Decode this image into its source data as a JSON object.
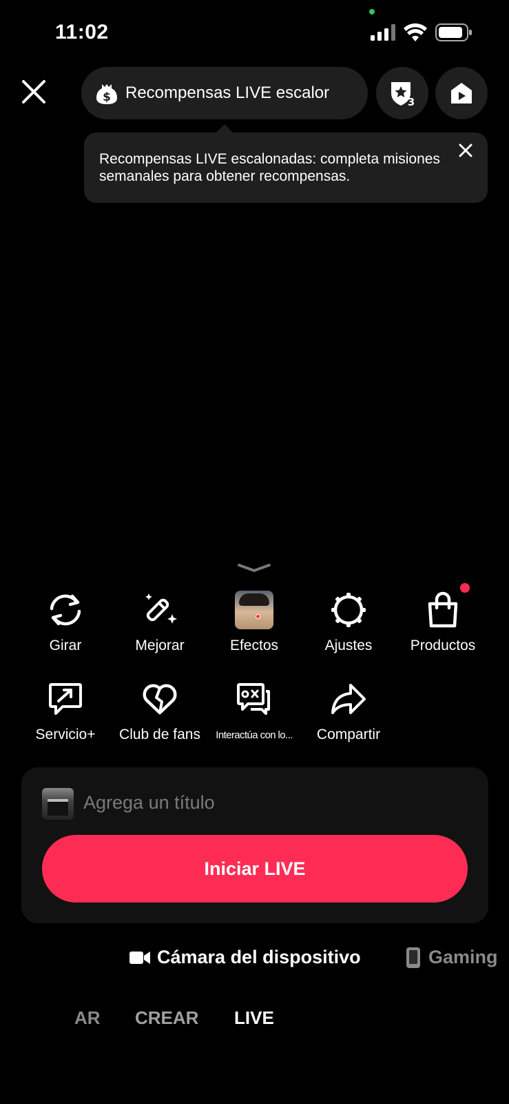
{
  "status_bar": {
    "time": "11:02",
    "icons": [
      "cellular-icon",
      "wifi-icon",
      "battery-icon"
    ],
    "camera_indicator_color": "#34c759"
  },
  "top_bar": {
    "close_icon": "close-icon",
    "rewards_label": "Recompensas LIVE escalor",
    "rewards_icon": "dollar-bag-icon",
    "badge_icon": "star-badge-icon",
    "badge_count": "3",
    "play_icon": "play-icon"
  },
  "tooltip": {
    "text": "Recompensas LIVE escalonadas: completa misiones semanales para obtener recompensas."
  },
  "tools": [
    {
      "label": "Girar",
      "icon": "rotate-icon"
    },
    {
      "label": "Mejorar",
      "icon": "magic-wand-icon"
    },
    {
      "label": "Efectos",
      "icon": "effect-face-thumbnail"
    },
    {
      "label": "Ajustes",
      "icon": "gear-icon"
    },
    {
      "label": "Productos",
      "icon": "shopping-bag-icon"
    },
    {
      "label": "Servicio+",
      "icon": "service-chat-icon"
    },
    {
      "label": "Club de fans",
      "icon": "heart-icon"
    },
    {
      "label": "Interactúa con lo...",
      "icon": "game-chat-icon"
    },
    {
      "label": "Compartir",
      "icon": "share-arrow-icon"
    }
  ],
  "card": {
    "title_placeholder": "Agrega un título",
    "start_button": "Iniciar LIVE"
  },
  "sources": {
    "camera": "Cámara del dispositivo",
    "gaming": "Gaming"
  },
  "modes": {
    "previous_partial": "AR",
    "crear": "CREAR",
    "live": "LIVE"
  },
  "colors": {
    "accent": "#fe2c55",
    "background": "#000000",
    "surface": "#1f1f1f",
    "card": "#121212",
    "muted_text": "#7a7a7a"
  }
}
